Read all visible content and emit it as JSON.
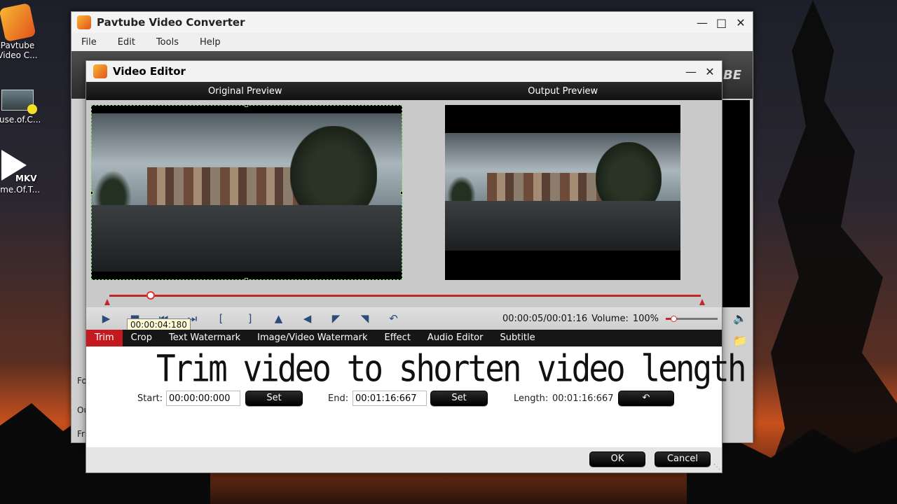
{
  "desktop": {
    "icons": [
      {
        "label_line1": "Pavtube",
        "label_line2": "Video C..."
      },
      {
        "label_line1": "ouse.of.C..."
      },
      {
        "label_line1": "ame.Of.T...",
        "badge": "MKV"
      }
    ]
  },
  "main_window": {
    "title": "Pavtube Video Converter",
    "menu": [
      "File",
      "Edit",
      "Tools",
      "Help"
    ],
    "brand_partial": "BE",
    "left_labels": [
      "Fo",
      "Ou",
      "Fr"
    ]
  },
  "video_editor": {
    "title": "Video Editor",
    "original_preview_label": "Original Preview",
    "output_preview_label": "Output Preview",
    "timeline": {
      "position_fraction": 0.07
    },
    "tooltip": "00:00:04:180",
    "time_readout": "00:00:05/00:01:16",
    "volume_label": "Volume:",
    "volume_value": "100%",
    "volume_fraction": 0.15,
    "tabs": [
      "Trim",
      "Crop",
      "Text Watermark",
      "Image/Video Watermark",
      "Effect",
      "Audio Editor",
      "Subtitle"
    ],
    "active_tab": "Trim",
    "caption": "Trim video to shorten video length",
    "trim": {
      "start_label": "Start:",
      "start_value": "00:00:00:000",
      "set_label": "Set",
      "end_label": "End:",
      "end_value": "00:01:16:667",
      "length_label": "Length:",
      "length_value": "00:01:16:667"
    },
    "ok_label": "OK",
    "cancel_label": "Cancel"
  },
  "colors": {
    "accent": "#c3191f",
    "tab_bar": "#161616",
    "crop_border": "#7fdc6a"
  }
}
